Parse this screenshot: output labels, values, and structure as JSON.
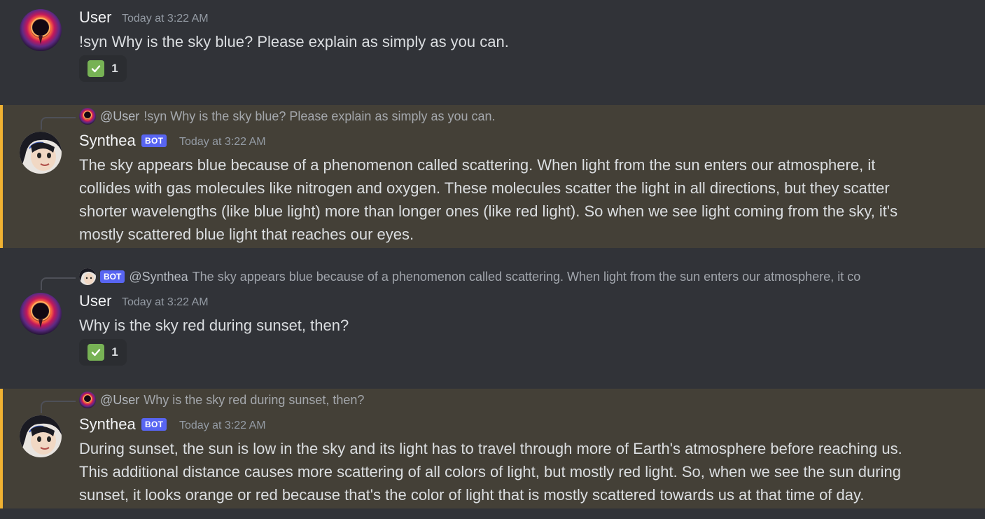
{
  "messages": [
    {
      "author": "User",
      "time": "Today at 3:22 AM",
      "text": "!syn Why is the sky blue? Please explain as simply as you can.",
      "reaction": {
        "emoji": "check-mark-button",
        "count": "1"
      }
    },
    {
      "author": "Synthea",
      "bot_tag": "BOT",
      "time": "Today at 3:22 AM",
      "reply": {
        "name": "@User",
        "text": "!syn Why is the sky blue? Please explain as simply as you can."
      },
      "lines": [
        "The sky appears blue because of a phenomenon called scattering. When light from the sun enters our atmosphere, it",
        "collides with gas molecules like nitrogen and oxygen. These molecules scatter the light in all directions, but they scatter",
        "shorter wavelengths (like blue light) more than longer ones (like red light). So when we see light coming from the sky, it's",
        "mostly scattered blue light that reaches our eyes."
      ]
    },
    {
      "author": "User",
      "time": "Today at 3:22 AM",
      "reply": {
        "bot_tag": "BOT",
        "name": "@Synthea",
        "text": "The sky appears blue because of a phenomenon called scattering. When light from the sun enters our atmosphere, it co"
      },
      "text": "Why is the sky red during sunset, then?",
      "reaction": {
        "emoji": "check-mark-button",
        "count": "1"
      }
    },
    {
      "author": "Synthea",
      "bot_tag": "BOT",
      "time": "Today at 3:22 AM",
      "reply": {
        "name": "@User",
        "text": "Why is the sky red during sunset, then?"
      },
      "lines": [
        "During sunset, the sun is low in the sky and its light has to travel through more of Earth's atmosphere before reaching us.",
        "This additional distance causes more scattering of all colors of light, but mostly red light. So, when we see the sun during",
        "sunset, it looks orange or red because that's the color of light that is mostly scattered towards us at that time of day."
      ]
    }
  ],
  "colors": {
    "background": "#313338",
    "mention_highlight": "#444037",
    "mention_bar": "#f0b232",
    "bot_tag": "#5865f2"
  }
}
